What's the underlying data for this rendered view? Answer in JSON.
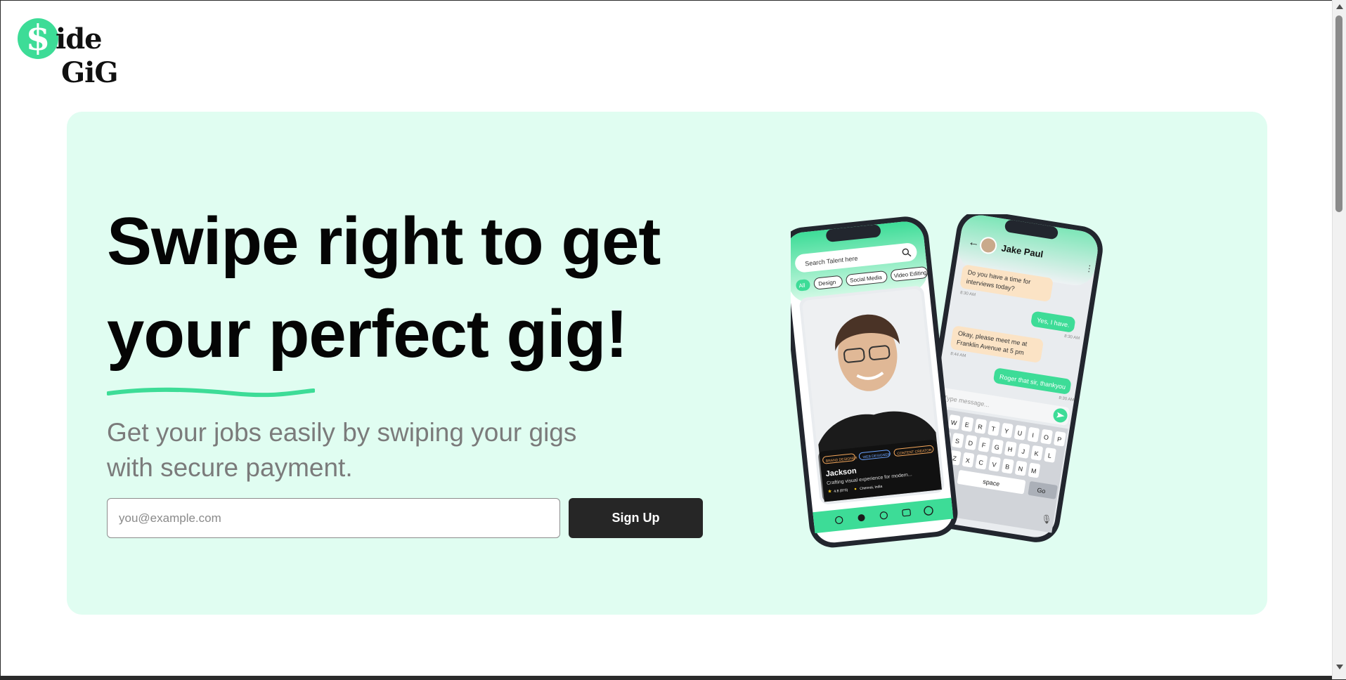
{
  "brand": {
    "logo_symbol": "$",
    "logo_line1": "ide",
    "logo_line2": "GiG",
    "accent_color": "#3ddc97"
  },
  "hero": {
    "headline": "Swipe right to get your perfect gig!",
    "subtitle": "Get your jobs easily by swiping your gigs with secure payment.",
    "email_placeholder": "you@example.com",
    "signup_label": "Sign Up",
    "background_color": "#e0fdf1"
  },
  "phone_left": {
    "search_placeholder": "Search Talent here",
    "filters": [
      "All",
      "Design",
      "Social Media",
      "Video Editing"
    ],
    "profile_tags": [
      "BRAND DESIGNER",
      "WEB DESIGNER",
      "CONTENT CREATOR"
    ],
    "profile_name": "Jackson",
    "profile_desc": "Crafting visual experience for modern...",
    "profile_rating": "4.8 (870)",
    "profile_location": "Chennai, India",
    "nav_icons": [
      "home-icon",
      "people-icon",
      "coin-icon",
      "wallet-icon",
      "profile-icon"
    ]
  },
  "phone_right": {
    "contact_name": "Jake Paul",
    "messages": [
      {
        "side": "in",
        "text": "Do you have a time for interviews today?",
        "time": "8:30 AM"
      },
      {
        "side": "out",
        "text": "Yes, I have.",
        "time": "8:30 AM"
      },
      {
        "side": "in",
        "text": "Okay, please meet me at Franklin Avenue at 5 pm",
        "time": "8:44 AM"
      },
      {
        "side": "out",
        "text": "Roger that sir, thankyou",
        "time": "8:30 AM"
      }
    ],
    "input_placeholder": "Type message...",
    "keyboard_rows": [
      "QWERTYUIOP",
      "ASDFGHJKL",
      "ZXCVBNM"
    ],
    "space_label": "space",
    "go_label": "Go"
  }
}
